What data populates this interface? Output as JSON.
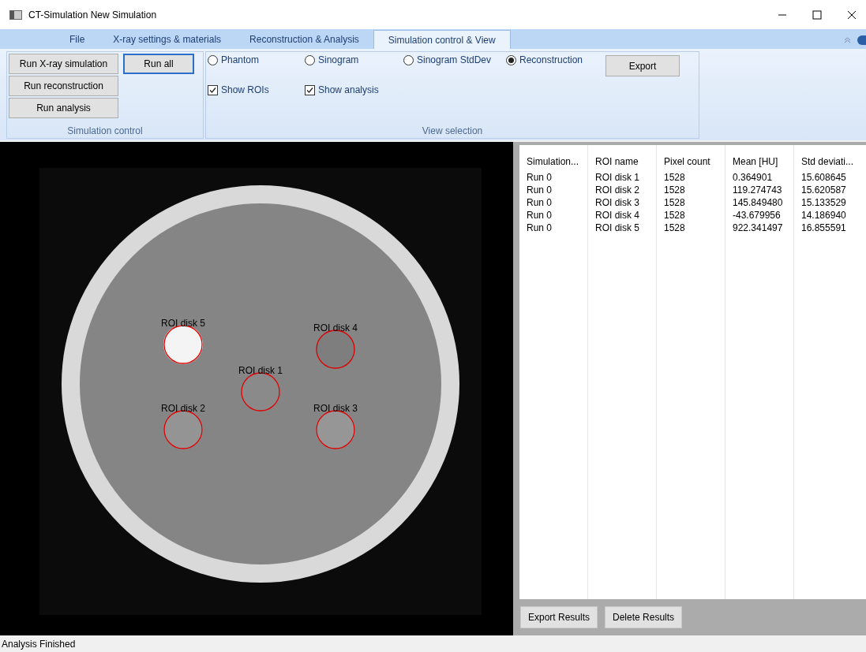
{
  "window": {
    "title": "CT-Simulation New Simulation"
  },
  "menu_tabs": [
    {
      "label": "File",
      "selected": false
    },
    {
      "label": "X-ray settings & materials",
      "selected": false
    },
    {
      "label": "Reconstruction & Analysis",
      "selected": false
    },
    {
      "label": "Simulation control & View",
      "selected": true
    }
  ],
  "simulation_control": {
    "title": "Simulation control",
    "buttons": [
      {
        "label": "Run X-ray simulation",
        "focused": false
      },
      {
        "label": "Run all",
        "focused": true
      },
      {
        "label": "Run reconstruction",
        "focused": false
      },
      {
        "label": "Run analysis",
        "focused": false
      }
    ]
  },
  "view_selection": {
    "title": "View selection",
    "views": [
      {
        "label": "Phantom",
        "selected": false
      },
      {
        "label": "Sinogram",
        "selected": false
      },
      {
        "label": "Sinogram StdDev",
        "selected": false
      },
      {
        "label": "Reconstruction",
        "selected": true
      }
    ],
    "options": [
      {
        "label": "Show ROIs",
        "checked": true
      },
      {
        "label": "Show analysis",
        "checked": true
      }
    ],
    "export_button": "Export"
  },
  "image": {
    "rois": [
      {
        "label": "ROI disk 1"
      },
      {
        "label": "ROI disk 2"
      },
      {
        "label": "ROI disk 3"
      },
      {
        "label": "ROI disk 4"
      },
      {
        "label": "ROI disk 5"
      }
    ]
  },
  "results_table": {
    "columns": [
      "Simulation...",
      "ROI name",
      "Pixel count",
      "Mean [HU]",
      "Std deviati..."
    ],
    "rows": [
      [
        "Run 0",
        "ROI disk 1",
        "1528",
        "0.364901",
        "15.608645"
      ],
      [
        "Run 0",
        "ROI disk 2",
        "1528",
        "119.274743",
        "15.620587"
      ],
      [
        "Run 0",
        "ROI disk 3",
        "1528",
        "145.849480",
        "15.133529"
      ],
      [
        "Run 0",
        "ROI disk 4",
        "1528",
        "-43.679956",
        "14.186940"
      ],
      [
        "Run 0",
        "ROI disk 5",
        "1528",
        "922.341497",
        "16.855591"
      ]
    ]
  },
  "result_buttons": [
    "Export Results",
    "Delete Results"
  ],
  "status_bar": "Analysis Finished"
}
